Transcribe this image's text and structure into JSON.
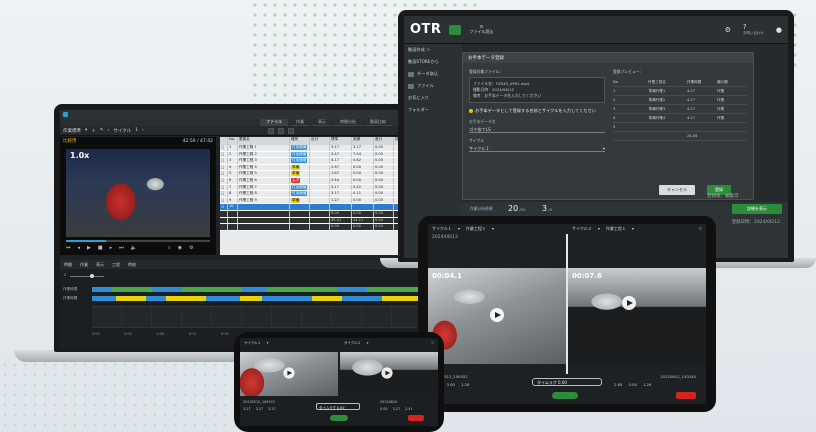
{
  "laptop_left": {
    "menu_tabs": [
      {
        "label": "ファイル"
      },
      {
        "label": "作業"
      },
      {
        "label": "表示"
      },
      {
        "label": "時間分析"
      },
      {
        "label": "動画比較"
      }
    ],
    "toolbar": {
      "category_label": "作業標準",
      "cycle_label": "サイクル",
      "cycle_value": "1",
      "white_btn": "TYPE"
    },
    "video": {
      "label": "比較用",
      "timecode": "42:50 / 47:42",
      "speed": "1.0x"
    },
    "table": {
      "columns": [
        "",
        "No.",
        "要素名",
        "種別",
        "区分",
        "標準",
        "実績",
        "差分",
        "評価"
      ],
      "rows": [
        {
          "no": "1",
          "name": "作業工程 1",
          "tag": "付加価値",
          "tag_color": "blue",
          "v1": "3.17",
          "v2": "3.17",
          "v3": "0.00"
        },
        {
          "no": "2",
          "name": "作業工程 2",
          "tag": "付加価値",
          "tag_color": "blue",
          "v1": "3.47",
          "v2": "7.44",
          "v3": "0.00"
        },
        {
          "no": "3",
          "name": "作業工程 3",
          "tag": "付加価値",
          "tag_color": "blue",
          "v1": "4.17",
          "v2": "4.62",
          "v3": "0.00"
        },
        {
          "no": "4",
          "name": "作業工程 4",
          "tag": "準備",
          "tag_color": "yellow",
          "v1": "2.67",
          "v2": "0.00",
          "v3": "0.00"
        },
        {
          "no": "5",
          "name": "作業工程 5",
          "tag": "準備",
          "tag_color": "yellow",
          "v1": "1.87",
          "v2": "0.00",
          "v3": "0.00"
        },
        {
          "no": "6",
          "name": "作業工程 6",
          "tag": "ムダ",
          "tag_color": "red",
          "v1": "2.44",
          "v2": "0.00",
          "v3": "0.00"
        },
        {
          "no": "7",
          "name": "作業工程 7",
          "tag": "付加価値",
          "tag_color": "blue",
          "v1": "4.17",
          "v2": "0.42",
          "v3": "0.00"
        },
        {
          "no": "8",
          "name": "作業工程 8",
          "tag": "付加価値",
          "tag_color": "blue",
          "v1": "3.17",
          "v2": "0.11",
          "v3": "0.00"
        },
        {
          "no": "9",
          "name": "作業工程 9",
          "tag": "準備",
          "tag_color": "yellow",
          "v1": "1.27",
          "v2": "0.00",
          "v3": "0.00"
        },
        {
          "no": "10",
          "name": "",
          "tag": "",
          "tag_color": "",
          "v1": "",
          "v2": "",
          "v3": "",
          "selected": true
        }
      ],
      "totals": [
        {
          "name": "",
          "v1": "0.00",
          "v2": "0.00",
          "v3": "0.00"
        },
        {
          "name": "",
          "v1": "45.01",
          "v2": "14.11",
          "v3": "0.00"
        },
        {
          "name": "",
          "v1": "0.00",
          "v2": "0.00",
          "v3": "0.00"
        }
      ]
    },
    "timeline": {
      "tabs": [
        {
          "label": "時間"
        },
        {
          "label": "作業"
        },
        {
          "label": "表示"
        },
        {
          "label": "工程"
        },
        {
          "label": "時刻"
        }
      ],
      "lanes": [
        {
          "label": "作業時間"
        },
        {
          "label": "作業時間"
        }
      ],
      "ticks": [
        "0:00",
        "0:04",
        "0:08",
        "0:12",
        "0:16",
        "0:20",
        "0:24",
        "0:28",
        "0:32",
        "0:36",
        "0:40"
      ]
    }
  },
  "laptop_right": {
    "logo": "OTR",
    "logo_sub": "",
    "menu_label": "ファイル読込",
    "header_icons": [
      {
        "icon": "gear-icon",
        "label": ""
      },
      {
        "icon": "help-icon",
        "label": "お問い合わせ"
      },
      {
        "icon": "user-icon",
        "label": ""
      }
    ],
    "breadcrumb": "動画作成 ＞",
    "sidebar": [
      {
        "label": "動画STOREから"
      },
      {
        "label": "データ取込"
      },
      {
        "label": "ファイル"
      },
      {
        "label": "お気に入り"
      },
      {
        "label": "フォルダー"
      }
    ],
    "modal": {
      "title": "お手本データ登録",
      "source_label": "登録対象ファイル：",
      "file_lines": [
        "ファイル名：YZS45_0991.mp4",
        "撮影日時：2024/06/12",
        "備考：お手本データ名入力してください"
      ],
      "notice": "お手本データとして登録する名前とサイクルを入力してください",
      "name_field_label": "お手本データ名",
      "name_value": "ゴミ捨てLS",
      "cycle_field_label": "サイクル",
      "cycle_value": "サイクル１",
      "preview_title": "登録プレビュー：",
      "preview_cols": [
        "No",
        "作業工程名",
        "作業時間",
        "種分類"
      ],
      "preview_rows": [
        {
          "no": "1",
          "name": "準備作業1",
          "time": "4.27",
          "type": "作業"
        },
        {
          "no": "2",
          "name": "準備作業2",
          "time": "4.27",
          "type": "作業"
        },
        {
          "no": "3",
          "name": "準備作業3",
          "time": "4.27",
          "type": "作業"
        },
        {
          "no": "4",
          "name": "準備作業4",
          "time": "4.27",
          "type": "作業"
        },
        {
          "no": "5",
          "name": "",
          "time": "",
          "type": ""
        }
      ],
      "preview_total": "24.04",
      "cancel": "キャンセル",
      "confirm": "登録",
      "confirm_note": "登録後、編集可"
    },
    "bottom": {
      "label": "作業分析結果",
      "count_a": "20",
      "count_a_unit": "/50",
      "count_b": "3",
      "count_b_unit": "/5",
      "wide_button": "詳細を表示",
      "side_info": "登録日時：2024/06/12"
    }
  },
  "tablet": {
    "left_head": "サイクル１",
    "left_head2": "作業工程１",
    "right_head": "サイクル２",
    "right_head2": "作業工程１",
    "left_date": "2024/06/12",
    "left_timer": "00:04.1",
    "right_timer": "00:07.6",
    "right_date": "",
    "bottom_left_a": "20230512_150552",
    "bottom_right_a": "20220812_150240",
    "pill_label": "タイムラグ",
    "pill_value": "0.00",
    "stats_left": [
      "2.65",
      "3.00",
      "1.26"
    ],
    "stats_right": [
      "2.65",
      "0.00",
      "1.26"
    ]
  },
  "phone": {
    "left_head": "サイクル１",
    "right_head": "サイクル２",
    "pill_label": "タイムラグ",
    "pill_value": "0.00",
    "bottom_left": "20230512_165922",
    "bottom_right": "20220810",
    "stats_left": [
      "3.27",
      "3.27",
      "3.27"
    ],
    "stats_right": [
      "0.00",
      "3.27",
      "2.41"
    ]
  }
}
